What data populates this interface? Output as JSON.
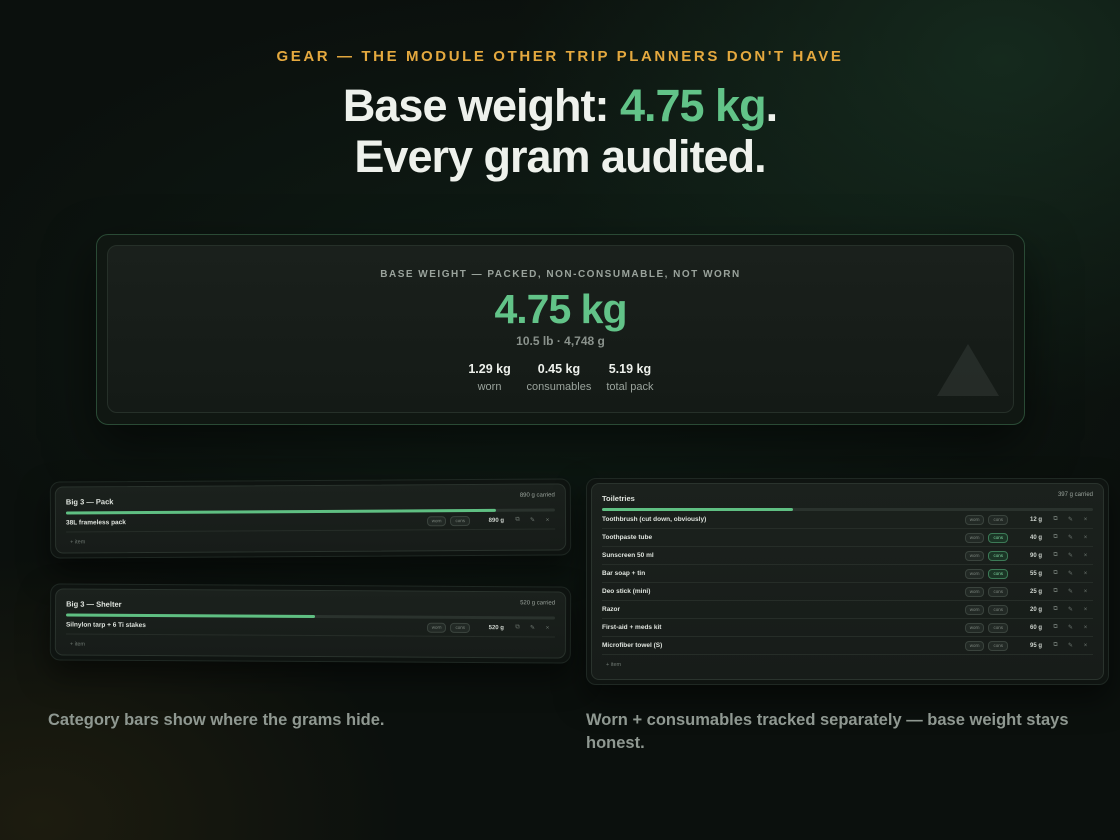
{
  "header": {
    "eyebrow": "GEAR — THE MODULE OTHER TRIP PLANNERS DON'T HAVE",
    "headline_prefix": "Base weight: ",
    "headline_accent": "4.75 kg",
    "headline_suffix": ".",
    "headline_line2": "Every gram audited."
  },
  "hero": {
    "label": "BASE WEIGHT — PACKED, NON-CONSUMABLE, NOT WORN",
    "value": "4.75 kg",
    "sub": "10.5 lb · 4,748 g",
    "stats": [
      {
        "value": "1.29 kg",
        "label": "worn"
      },
      {
        "value": "0.45 kg",
        "label": "consumables"
      },
      {
        "value": "5.19 kg",
        "label": "total pack"
      }
    ],
    "icon": "tent-icon"
  },
  "categories": {
    "pack": {
      "title": "Big 3 — Pack",
      "carried": "890 g carried",
      "fill_fraction": 0.88,
      "items": [
        {
          "name": "38L frameless pack",
          "chip_worn": "worn",
          "chip_cons": "cons",
          "cons_active": false,
          "weight": "890 g"
        }
      ],
      "add_label": "+ item"
    },
    "shelter": {
      "title": "Big 3 — Shelter",
      "carried": "520 g carried",
      "fill_fraction": 0.51,
      "items": [
        {
          "name": "Silnylon tarp + 6 Ti stakes",
          "chip_worn": "worn",
          "chip_cons": "cons",
          "cons_active": false,
          "weight": "520 g"
        }
      ],
      "add_label": "+ item"
    },
    "toiletries": {
      "title": "Toiletries",
      "carried": "397 g carried",
      "fill_fraction": 0.39,
      "items": [
        {
          "name": "Toothbrush (cut down, obviously)",
          "chip_worn": "worn",
          "chip_cons": "cons",
          "cons_active": false,
          "weight": "12 g"
        },
        {
          "name": "Toothpaste tube",
          "chip_worn": "worn",
          "chip_cons": "cons",
          "cons_active": true,
          "weight": "40 g"
        },
        {
          "name": "Sunscreen 50 ml",
          "chip_worn": "worn",
          "chip_cons": "cons",
          "cons_active": true,
          "weight": "90 g"
        },
        {
          "name": "Bar soap + tin",
          "chip_worn": "worn",
          "chip_cons": "cons",
          "cons_active": true,
          "weight": "55 g"
        },
        {
          "name": "Deo stick (mini)",
          "chip_worn": "worn",
          "chip_cons": "cons",
          "cons_active": false,
          "weight": "25 g"
        },
        {
          "name": "Razor",
          "chip_worn": "worn",
          "chip_cons": "cons",
          "cons_active": false,
          "weight": "20 g"
        },
        {
          "name": "First-aid + meds kit",
          "chip_worn": "worn",
          "chip_cons": "cons",
          "cons_active": false,
          "weight": "60 g"
        },
        {
          "name": "Microfiber towel (S)",
          "chip_worn": "worn",
          "chip_cons": "cons",
          "cons_active": false,
          "weight": "95 g"
        }
      ],
      "add_label": "+ item"
    }
  },
  "row_actions": {
    "duplicate": "⧉",
    "edit": "✎",
    "delete": "×"
  },
  "captions": {
    "left": "Category bars show where the grams hide.",
    "right": "Worn + consumables tracked separately — base weight stays honest."
  },
  "colors": {
    "accent": "#62c388",
    "eyebrow": "#e5a93f",
    "background": "#0b100d"
  }
}
